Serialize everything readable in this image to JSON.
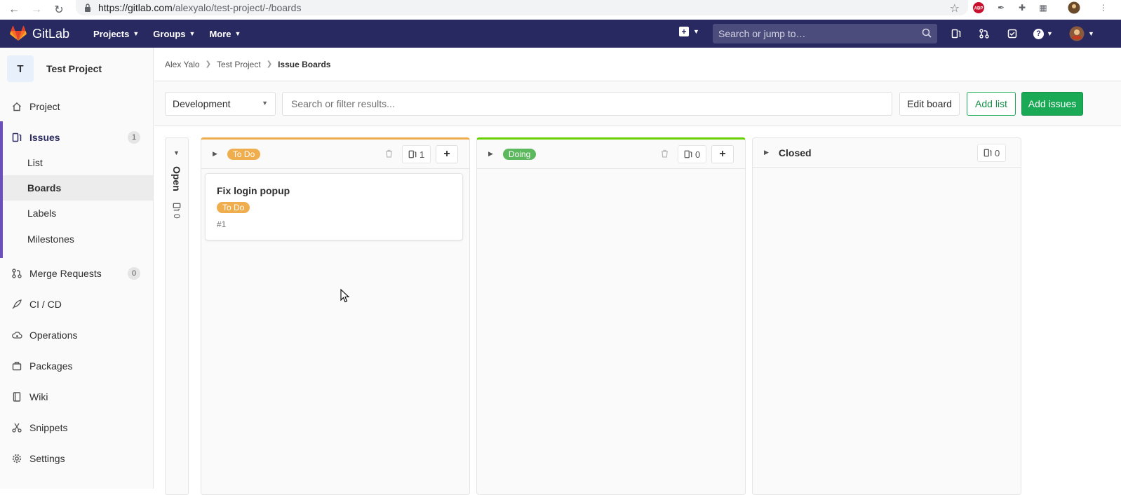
{
  "browser": {
    "url_host": "https://gitlab.com",
    "url_path": "/alexyalo/test-project/-/boards",
    "ext_abp": "ABP"
  },
  "topbar": {
    "logo_text": "GitLab",
    "nav": [
      {
        "label": "Projects"
      },
      {
        "label": "Groups"
      },
      {
        "label": "More"
      }
    ],
    "search_placeholder": "Search or jump to…"
  },
  "sidebar": {
    "project_initial": "T",
    "project_name": "Test Project",
    "items": {
      "project": "Project",
      "issues": "Issues",
      "issues_count": "1",
      "list": "List",
      "boards": "Boards",
      "labels": "Labels",
      "milestones": "Milestones",
      "merge_requests": "Merge Requests",
      "merge_requests_count": "0",
      "cicd": "CI / CD",
      "operations": "Operations",
      "packages": "Packages",
      "wiki": "Wiki",
      "snippets": "Snippets",
      "settings": "Settings"
    }
  },
  "breadcrumb": {
    "owner": "Alex Yalo",
    "project": "Test Project",
    "current": "Issue Boards"
  },
  "filterbar": {
    "board_name": "Development",
    "filter_placeholder": "Search or filter results...",
    "edit_board": "Edit board",
    "add_list": "Add list",
    "add_issues": "Add issues"
  },
  "board": {
    "open_list": {
      "label": "Open",
      "count": "0"
    },
    "lists": [
      {
        "label": "To Do",
        "count": "1",
        "color": "#f0ad4e",
        "cards": [
          {
            "title": "Fix login popup",
            "label": "To Do",
            "ref": "#1"
          }
        ]
      },
      {
        "label": "Doing",
        "count": "0",
        "color": "#5cb85c",
        "cards": []
      },
      {
        "label": "Closed",
        "count": "0",
        "cards": []
      }
    ]
  },
  "colors": {
    "navbar": "#292961",
    "accent_green": "#1aaa55",
    "todo": "#f0ad4e",
    "doing": "#5cb85c"
  }
}
